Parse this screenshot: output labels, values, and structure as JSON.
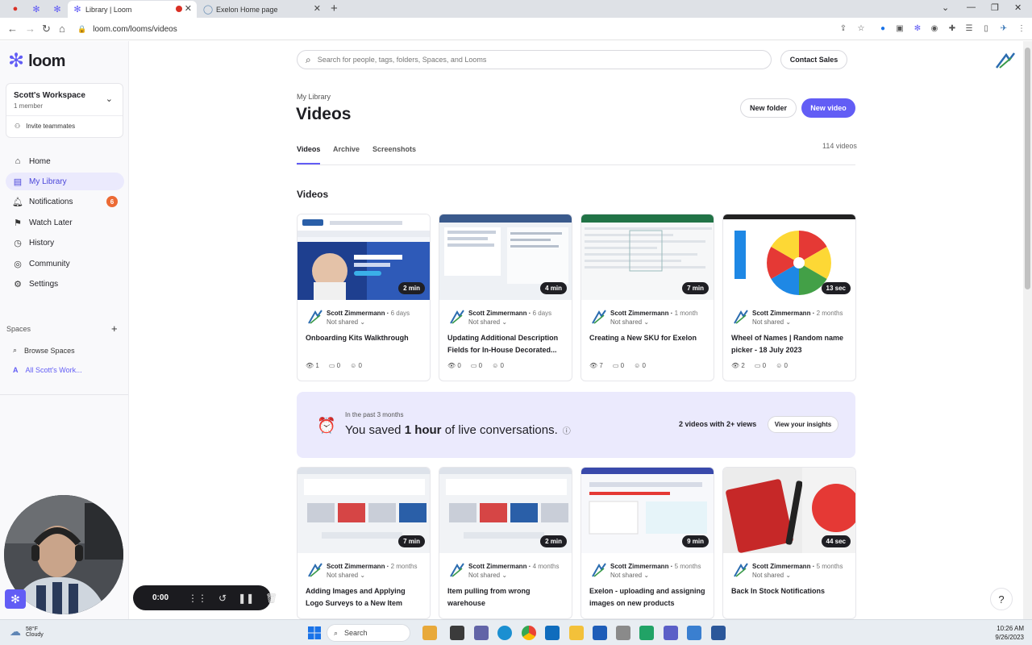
{
  "browser": {
    "tabs": [
      {
        "title": "Library | Loom",
        "active": true
      },
      {
        "title": "Exelon Home page",
        "active": false
      }
    ],
    "url": "loom.com/looms/videos"
  },
  "sidebar": {
    "brand": "loom",
    "workspace": {
      "name": "Scott's Workspace",
      "members": "1 member",
      "invite": "Invite teammates"
    },
    "items": [
      {
        "label": "Home",
        "icon": "home-icon"
      },
      {
        "label": "My Library",
        "icon": "library-icon",
        "active": true
      },
      {
        "label": "Notifications",
        "icon": "bell-icon",
        "badge": "6"
      },
      {
        "label": "Watch Later",
        "icon": "bookmark-icon"
      },
      {
        "label": "History",
        "icon": "clock-icon"
      },
      {
        "label": "Community",
        "icon": "globe-icon"
      },
      {
        "label": "Settings",
        "icon": "gear-icon"
      }
    ],
    "spaces_heading": "Spaces",
    "spaces": [
      {
        "label": "Browse Spaces",
        "icon": "search-icon"
      },
      {
        "label": "All Scott's Work...",
        "icon": "A"
      }
    ]
  },
  "recorder": {
    "time": "0:00"
  },
  "header": {
    "search_placeholder": "Search for people, tags, folders, Spaces, and Looms",
    "contact_sales": "Contact Sales"
  },
  "page": {
    "breadcrumb": "My Library",
    "title": "Videos",
    "new_folder": "New folder",
    "new_video": "New video",
    "tabs": [
      "Videos",
      "Archive",
      "Screenshots"
    ],
    "count": "114 videos",
    "section": "Videos"
  },
  "videos_row1": [
    {
      "owner": "Scott Zimmermann",
      "when": "6 days",
      "shared": "Not shared",
      "title": "Onboarding Kits Walkthrough",
      "duration": "2 min",
      "views": "1",
      "comments": "0",
      "reactions": "0"
    },
    {
      "owner": "Scott Zimmermann",
      "when": "6 days",
      "shared": "Not shared",
      "title": "Updating Additional Description Fields for In-House Decorated...",
      "duration": "4 min",
      "views": "0",
      "comments": "0",
      "reactions": "0"
    },
    {
      "owner": "Scott Zimmermann",
      "when": "1 month",
      "shared": "Not shared",
      "title": "Creating a New SKU for Exelon",
      "duration": "7 min",
      "views": "7",
      "comments": "0",
      "reactions": "0"
    },
    {
      "owner": "Scott Zimmermann",
      "when": "2 months",
      "shared": "Not shared",
      "title": "Wheel of Names | Random name picker - 18 July 2023",
      "duration": "13 sec",
      "views": "2",
      "comments": "0",
      "reactions": "0"
    }
  ],
  "insights": {
    "period": "In the past 3 months",
    "saved_prefix": "You saved ",
    "saved_bold": "1 hour",
    "saved_suffix": " of live conversations.",
    "views": "2 videos with 2+ views",
    "button": "View your insights"
  },
  "videos_row2": [
    {
      "owner": "Scott Zimmermann",
      "when": "2 months",
      "shared": "Not shared",
      "title": "Adding Images and Applying Logo Surveys to a New Item",
      "duration": "7 min"
    },
    {
      "owner": "Scott Zimmermann",
      "when": "4 months",
      "shared": "Not shared",
      "title": "Item pulling from wrong warehouse",
      "duration": "2 min"
    },
    {
      "owner": "Scott Zimmermann",
      "when": "5 months",
      "shared": "Not shared",
      "title": "Exelon - uploading and assigning images on new products",
      "duration": "9 min"
    },
    {
      "owner": "Scott Zimmermann",
      "when": "5 months",
      "shared": "Not shared",
      "title": "Back In Stock Notifications",
      "duration": "44 sec"
    }
  ],
  "taskbar": {
    "temp": "58°F",
    "condition": "Cloudy",
    "search": "Search",
    "time": "10:26 AM",
    "date": "9/26/2023"
  },
  "colors": {
    "accent": "#625df5",
    "badge": "#ec6a34",
    "insights_bg": "#ebeafd"
  }
}
